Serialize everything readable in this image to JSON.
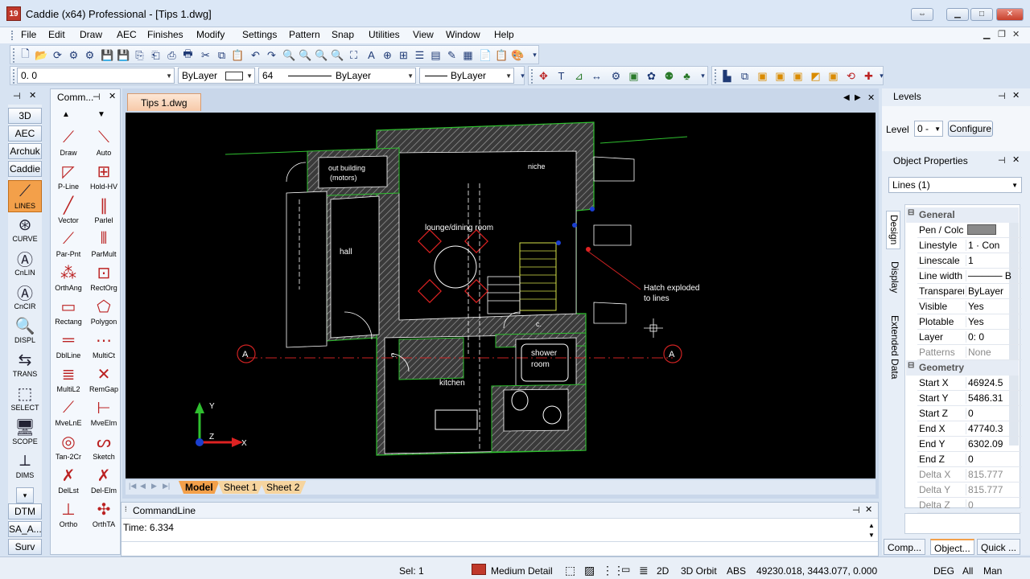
{
  "window": {
    "title": "Caddie (x64) Professional - [Tips 1.dwg]",
    "app_icon": "19",
    "controls": [
      "restore-down",
      "minimize",
      "maximize",
      "close"
    ]
  },
  "menu": [
    "File",
    "Edit",
    "Draw",
    "AEC",
    "Finishes",
    "Modify",
    "Settings",
    "Pattern",
    "Snap",
    "Utilities",
    "View",
    "Window",
    "Help"
  ],
  "toolbar_props": {
    "coord_value": "0. 0",
    "color_label": "ByLayer",
    "width_value": "64",
    "linetype_label": "ByLayer",
    "line_label": "ByLayer"
  },
  "left_tabs": [
    "3D",
    "AEC",
    "Archuk",
    "Caddie",
    "DTM",
    "SA_A...",
    "Surv"
  ],
  "left_tools": [
    {
      "icon": "lines-icon",
      "label": "LINES"
    },
    {
      "icon": "curve-icon",
      "label": "CURVE"
    },
    {
      "icon": "cnlin-icon",
      "label": "CnLIN"
    },
    {
      "icon": "cncir-icon",
      "label": "CnCIR"
    },
    {
      "icon": "displ-icon",
      "label": "DISPL"
    },
    {
      "icon": "trans-icon",
      "label": "TRANS"
    },
    {
      "icon": "select-icon",
      "label": "SELECT"
    },
    {
      "icon": "scope-icon",
      "label": "SCOPE"
    },
    {
      "icon": "dims-icon",
      "label": "DIMS"
    }
  ],
  "command_panel": {
    "title": "Comm...",
    "tools": [
      "Draw",
      "Auto",
      "P-Line",
      "Hold-HV",
      "Vector",
      "Parlel",
      "Par-Pnt",
      "ParMult",
      "OrthAng",
      "RectOrg",
      "Rectang",
      "Polygon",
      "DblLine",
      "MultiCt",
      "MultiL2",
      "RemGap",
      "MveLnE",
      "MveElm",
      "Tan-2Cr",
      "Sketch",
      "DelLst",
      "Del-Elm",
      "Ortho",
      "OrthTA"
    ]
  },
  "document": {
    "tab_label": "Tips 1.dwg",
    "sheet_tabs": [
      "Model",
      "Sheet 1",
      "Sheet 2"
    ],
    "drawing_labels": {
      "outbuilding_1": "out building",
      "outbuilding_2": "(motors)",
      "niche": "niche",
      "lounge": "lounge/dining room",
      "hall": "hall",
      "kitchen": "kitchen",
      "shower_1": "shower",
      "shower_2": "room",
      "small_c1": "c.",
      "small_c2": "c.",
      "section_a1": "A",
      "section_a2": "A",
      "note_1": "Hatch exploded",
      "note_2": "to lines",
      "axis_x": "X",
      "axis_y": "Y",
      "axis_z": "Z"
    }
  },
  "command_line": {
    "title": "CommandLine",
    "output": "Time: 6.334"
  },
  "levels_panel": {
    "title": "Levels",
    "level_label": "Level",
    "level_value": "0 -",
    "configure_label": "Configure"
  },
  "object_properties": {
    "title": "Object Properties",
    "selection": "Lines (1)",
    "side_tabs": [
      "Design",
      "Display",
      "Extended Data"
    ],
    "sections": {
      "general": "General",
      "geometry": "Geometry"
    },
    "general": [
      {
        "key": "Pen / Colc",
        "value": ""
      },
      {
        "key": "Linestyle",
        "value": "1  · Con"
      },
      {
        "key": "Linescale",
        "value": "1"
      },
      {
        "key": "Line width",
        "value": "───── B"
      },
      {
        "key": "Transparer",
        "value": "ByLayer"
      },
      {
        "key": "Visible",
        "value": "Yes"
      },
      {
        "key": "Plotable",
        "value": "Yes"
      },
      {
        "key": "Layer",
        "value": "0: 0"
      },
      {
        "key": "Patterns",
        "value": "None"
      }
    ],
    "geometry": [
      {
        "key": "Start X",
        "value": "46924.5"
      },
      {
        "key": "Start Y",
        "value": "5486.31"
      },
      {
        "key": "Start Z",
        "value": "0"
      },
      {
        "key": "End X",
        "value": "47740.3"
      },
      {
        "key": "End Y",
        "value": "6302.09"
      },
      {
        "key": "End Z",
        "value": "0"
      },
      {
        "key": "Delta X",
        "value": "815.777"
      },
      {
        "key": "Delta Y",
        "value": "815.777"
      },
      {
        "key": "Delta Z",
        "value": "0"
      }
    ],
    "bottom_tabs": [
      "Comp...",
      "Object...",
      "Quick ..."
    ]
  },
  "status": {
    "sel": "Sel: 1",
    "detail": "Medium Detail",
    "mode_2d": "2D",
    "orbit": "3D Orbit",
    "abs": "ABS",
    "coords": "49230.018, 3443.077, 0.000",
    "deg": "DEG",
    "all": "All",
    "man": "Man"
  },
  "colors": {
    "hatch": "#8a8a8a",
    "wall_outline": "#2fbf2f",
    "section_line": "#cc2222",
    "accent_tab": "#f3a04a",
    "title_bg": "#dbe7f6"
  }
}
